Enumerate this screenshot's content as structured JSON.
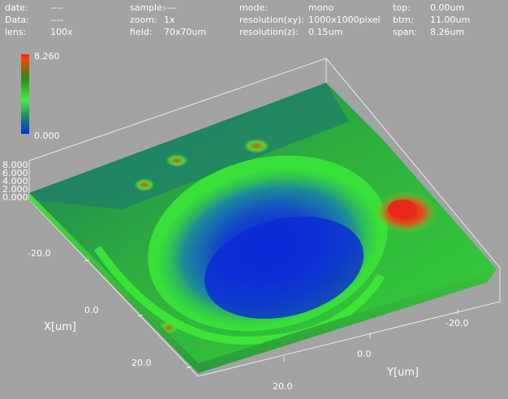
{
  "header": {
    "col1": [
      {
        "label": "date:",
        "value": "----"
      },
      {
        "label": "Data:",
        "value": "----"
      },
      {
        "label": "lens:",
        "value": "100x"
      }
    ],
    "col2": [
      {
        "label": "sample:",
        "value": "----"
      },
      {
        "label": "zoom:",
        "value": "1x"
      },
      {
        "label": "field:",
        "value": "70x70um"
      }
    ],
    "col3": [
      {
        "label": "mode:",
        "value": "mono"
      },
      {
        "label": "resolution(xy):",
        "value": "1000x1000pixel"
      },
      {
        "label": "resolution(z):",
        "value": "0.15um"
      }
    ],
    "col4": [
      {
        "label": "top:",
        "value": "0.00um"
      },
      {
        "label": "btm:",
        "value": "11.00um"
      },
      {
        "label": "span:",
        "value": "8.26um"
      }
    ]
  },
  "color_scale": {
    "max": "8.260",
    "min": "0.000"
  },
  "axes": {
    "z_ticks": [
      "8.000",
      "6.000",
      "4.000",
      "2.000",
      "0.000"
    ],
    "x_ticks": [
      "-20.0",
      "0.0",
      "20.0"
    ],
    "y_ticks": [
      "-20.0",
      "0.0",
      "20.0"
    ],
    "x_title": "X[um]",
    "y_title": "Y[um]"
  },
  "colors": {
    "background": "#a3a3a3",
    "high": "#e8281a",
    "mid": "#3ee63c",
    "low": "#0a2ad8"
  }
}
